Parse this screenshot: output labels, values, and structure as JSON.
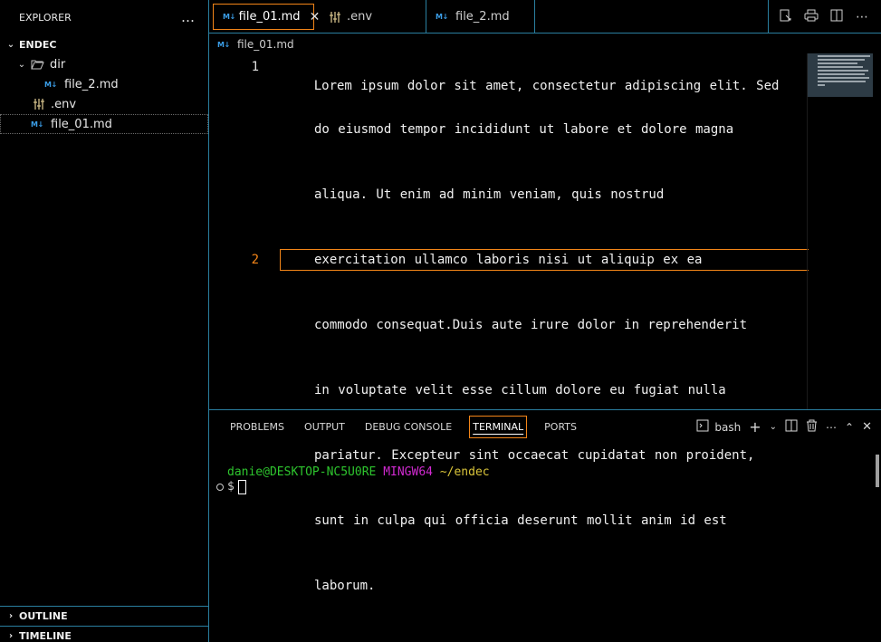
{
  "sidebar": {
    "title": "EXPLORER",
    "more": "…",
    "root": "ENDEC",
    "folder": "dir",
    "folder_child": "file_2.md",
    "files": [
      ".env",
      "file_01.md"
    ],
    "outline": "OUTLINE",
    "timeline": "TIMELINE"
  },
  "tabs": [
    {
      "label": "file_01.md",
      "icon": "markdown-icon",
      "active": true
    },
    {
      "label": ".env",
      "icon": "env-icon",
      "active": false
    },
    {
      "label": "file_2.md",
      "icon": "markdown-icon",
      "active": false
    }
  ],
  "tab_close": "✕",
  "breadcrumb": "file_01.md",
  "editor": {
    "line_numbers": [
      "1",
      "2"
    ],
    "first_line": "Lorem ipsum dolor sit amet, consectetur adipiscing elit. Sed",
    "wrapped_lines": [
      "do eiusmod tempor incididunt ut labore et dolore magna",
      "aliqua. Ut enim ad minim veniam, quis nostrud",
      "exercitation ullamco laboris nisi ut aliquip ex ea",
      "commodo consequat.Duis aute irure dolor in reprehenderit",
      "in voluptate velit esse cillum dolore eu fugiat nulla",
      "pariatur. Excepteur sint occaecat cupidatat non proident,",
      "sunt in culpa qui officia deserunt mollit anim id est",
      "laborum."
    ]
  },
  "panel": {
    "tabs": [
      "PROBLEMS",
      "OUTPUT",
      "DEBUG CONSOLE",
      "TERMINAL",
      "PORTS"
    ],
    "active_tab": "TERMINAL",
    "shell": "bash",
    "prompt_user": "danie@DESKTOP-NC5U0RE",
    "prompt_host": "MINGW64",
    "prompt_path": "~/endec",
    "prompt_symbol": "$"
  },
  "colors": {
    "accent_border": "#f38518",
    "divider": "#2a7fa0",
    "md_icon": "#3b9ee8",
    "terminal_user": "#2ec52e",
    "terminal_host": "#d12ad1",
    "terminal_path": "#d9c43a"
  }
}
